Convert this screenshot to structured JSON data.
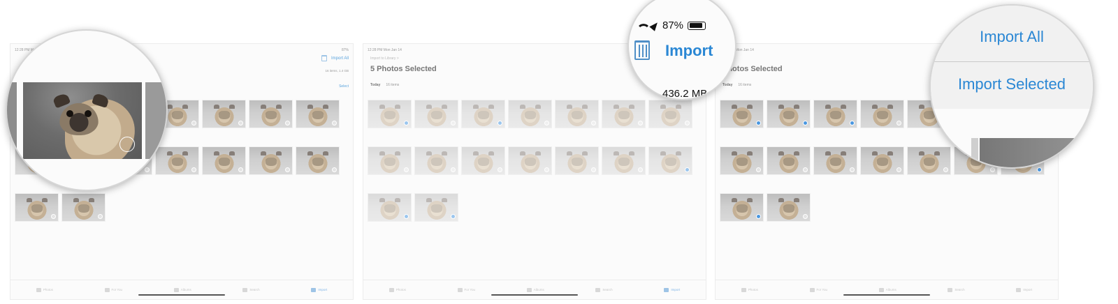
{
  "panels": [
    {
      "status_time": "12:28 PM  Mon Jan 14",
      "status_right": "87%",
      "crumb": "",
      "title": "",
      "section_label": "",
      "section_count": "",
      "nav_action": "Import All",
      "sub_info": "16 items, 1.4 GB",
      "select_label": "Select",
      "tabs": [
        "Photos",
        "For You",
        "Albums",
        "Search",
        "Import"
      ]
    },
    {
      "status_time": "12:28 PM  Mon Jan 14",
      "status_right": "",
      "crumb": "Import to Library >",
      "title": "5 Photos Selected",
      "section_label": "Today",
      "section_count": "16 items",
      "nav_action": "",
      "sub_info": "",
      "select_label": "",
      "tabs": [
        "Photos",
        "For You",
        "Albums",
        "Search",
        "Import"
      ]
    },
    {
      "status_time": "12:28 PM  Mon Jan 14",
      "status_right": "",
      "crumb": "",
      "title": "Photos Selected",
      "section_label": "Today",
      "section_count": "16 items",
      "nav_action": "",
      "sub_info": "",
      "select_label": "",
      "tabs": [
        "Photos",
        "For You",
        "Albums",
        "Search",
        "Import"
      ]
    }
  ],
  "magnifier_status": {
    "battery": "87%",
    "import_label": "Import",
    "size": "436.2 MB"
  },
  "magnifier_menu": {
    "item1": "Import All",
    "item2": "Import Selected"
  },
  "colors": {
    "accent": "#2a87d4",
    "check_selected": "#4a97e0"
  }
}
